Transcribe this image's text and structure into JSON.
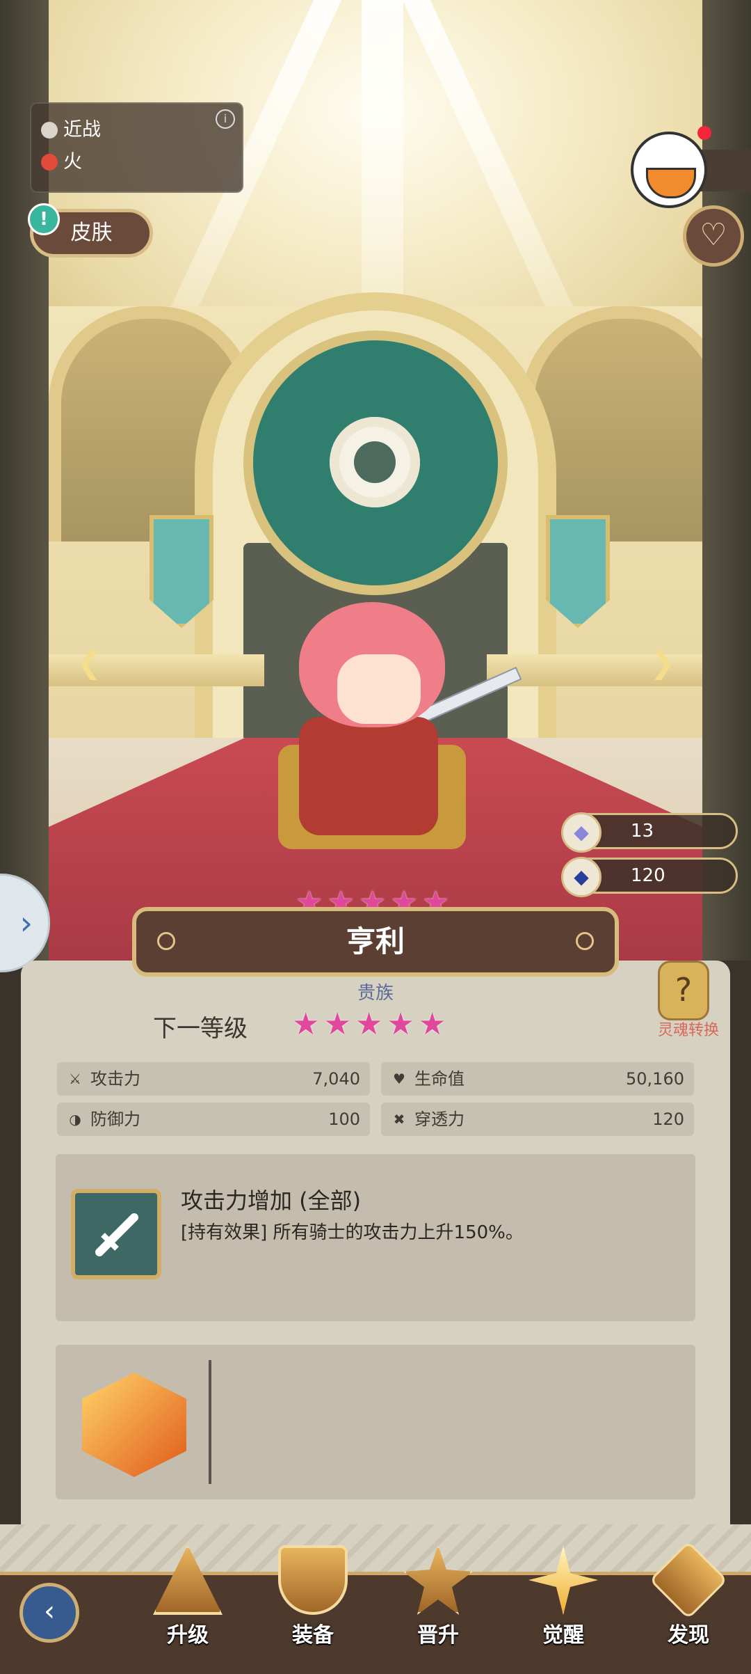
{
  "attributes": [
    {
      "label": "近战",
      "icon": "sword-class-icon"
    },
    {
      "label": "火",
      "icon": "fire-element-icon"
    }
  ],
  "skin_button": {
    "label": "皮肤"
  },
  "currencies": [
    {
      "icon": "crystal-icon",
      "value": "13"
    },
    {
      "icon": "blue-gem-icon",
      "value": "120"
    }
  ],
  "hero": {
    "name": "亨利",
    "stars": 5,
    "rarity": "贵族"
  },
  "next_level": {
    "label": "下一等级",
    "stars": 5
  },
  "soul_transfer": {
    "label": "灵魂转换"
  },
  "stats": [
    {
      "label": "攻击力",
      "value": "7,040",
      "icon": "attack-icon"
    },
    {
      "label": "生命值",
      "value": "50,160",
      "icon": "hp-icon"
    },
    {
      "label": "防御力",
      "value": "100",
      "icon": "defense-icon"
    },
    {
      "label": "穿透力",
      "value": "120",
      "icon": "penetration-icon"
    }
  ],
  "effect": {
    "title": "攻击力增加 (全部)",
    "description": "[持有效果] 所有骑士的攻击力上升150%。"
  },
  "nav": [
    {
      "label": "升级",
      "icon": "upgrade-icon"
    },
    {
      "label": "装备",
      "icon": "equipment-shield-icon"
    },
    {
      "label": "晋升",
      "icon": "promotion-star-icon"
    },
    {
      "label": "觉醒",
      "icon": "awaken-star-icon",
      "active": true
    },
    {
      "label": "发现",
      "icon": "discover-icon"
    }
  ],
  "colors": {
    "star": "#e0489b",
    "banner": "#5b3f33",
    "panel": "#d7d1c1",
    "gold_border": "#d9bb7e"
  }
}
